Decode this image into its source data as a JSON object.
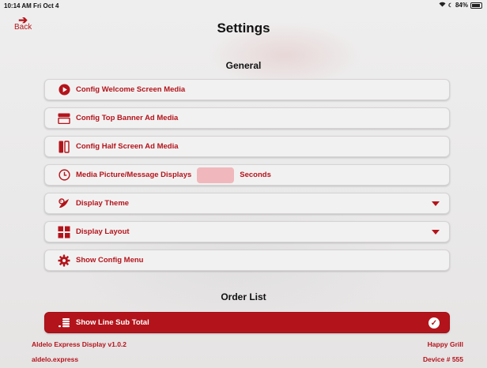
{
  "status_bar": {
    "time": "10:14 AM  Fri Oct 4",
    "battery": "84%"
  },
  "header": {
    "back_label": "Back",
    "title": "Settings"
  },
  "general": {
    "title": "General",
    "items": [
      {
        "label": "Config Welcome Screen Media",
        "icon": "play-circle-icon"
      },
      {
        "label": "Config Top Banner Ad Media",
        "icon": "banner-icon"
      },
      {
        "label": "Config Half Screen Ad Media",
        "icon": "half-screen-icon"
      },
      {
        "label": "Media Picture/Message Displays",
        "icon": "clock-icon",
        "suffix": "Seconds",
        "value": ""
      },
      {
        "label": "Display Theme",
        "icon": "palette-icon"
      },
      {
        "label": "Display Layout",
        "icon": "grid-icon"
      },
      {
        "label": "Show Config Menu",
        "icon": "gear-icon"
      }
    ]
  },
  "order_list": {
    "title": "Order List",
    "items": [
      {
        "label": "Show Line Sub Total",
        "icon": "coins-icon",
        "checked": true
      }
    ]
  },
  "footer": {
    "app_version": "Aldelo Express Display v1.0.2",
    "website": "aldelo.express",
    "store_name": "Happy Grill",
    "device": "Device # 555"
  },
  "colors": {
    "accent": "#b3141b",
    "background": "#eceaea"
  }
}
